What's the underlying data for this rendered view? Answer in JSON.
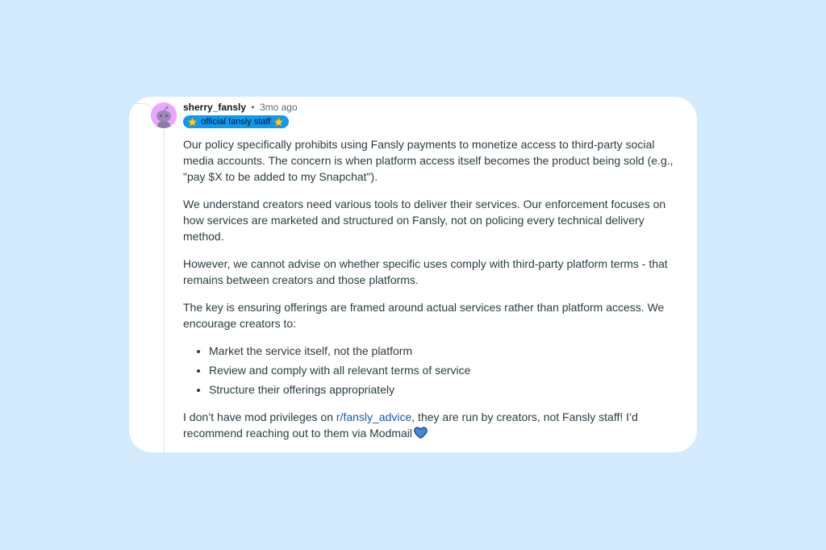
{
  "comment": {
    "username": "sherry_fansly",
    "separator": "•",
    "timestamp": "3mo ago",
    "flair": "official fansly staff",
    "avatar_color": "#e9a7ff",
    "flair_color": "#0d9af2",
    "flair_icon": "star-icon",
    "paragraphs": [
      "Our policy specifically prohibits using Fansly payments to monetize access to third-party social media accounts. The concern is when platform access itself becomes the product being sold (e.g., \"pay $X to be added to my Snapchat\").",
      "We understand creators need various tools to deliver their services. Our enforcement focuses on how services are marketed and structured on Fansly, not on policing every technical delivery method.",
      "However, we cannot advise on whether specific uses comply with third-party platform terms - that remains between creators and those platforms.",
      "The key is ensuring offerings are framed around actual services rather than platform access. We encourage creators to:"
    ],
    "bullets": [
      "Market the service itself, not the platform",
      "Review and comply with all relevant terms of service",
      "Structure their offerings appropriately"
    ],
    "closing": {
      "before_link": "I don’t have mod privileges on ",
      "link_text": "r/fansly_advice",
      "after_link": ", they are run by creators, not Fansly staff! I’d recommend reaching out to them via Modmail",
      "emoji": "blue-heart-icon"
    }
  }
}
